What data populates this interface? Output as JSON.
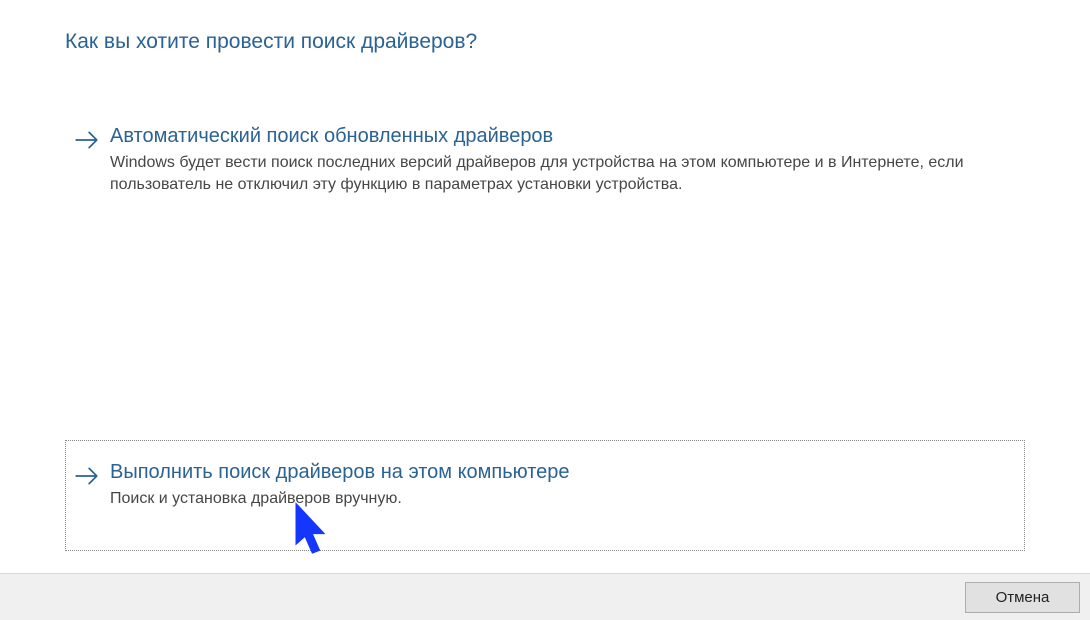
{
  "title": "Как вы хотите провести поиск драйверов?",
  "options": [
    {
      "title": "Автоматический поиск обновленных драйверов",
      "desc": "Windows будет вести поиск последних версий драйверов для устройства на этом компьютере и в Интернете, если пользователь не отключил эту функцию в параметрах установки устройства."
    },
    {
      "title": "Выполнить поиск драйверов на этом компьютере",
      "desc": "Поиск и установка драйверов вручную."
    }
  ],
  "footer": {
    "cancel_label": "Отмена"
  }
}
